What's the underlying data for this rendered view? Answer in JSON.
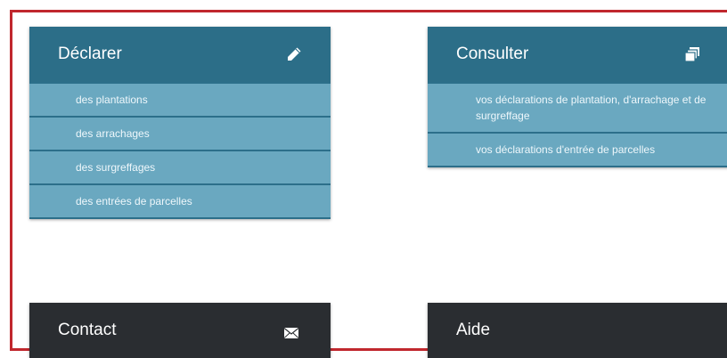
{
  "declarer": {
    "title": "Déclarer",
    "icon": "pencil-icon",
    "items": [
      {
        "label": "des plantations"
      },
      {
        "label": "des arrachages"
      },
      {
        "label": "des surgreffages"
      },
      {
        "label": "des entrées de parcelles"
      }
    ]
  },
  "consulter": {
    "title": "Consulter",
    "icon": "windows-stack-icon",
    "items": [
      {
        "label": "vos déclarations de plantation, d'arrachage et de surgreffage"
      },
      {
        "label": "vos déclarations d'entrée de parcelles"
      }
    ]
  },
  "contact": {
    "title": "Contact",
    "icon": "envelope-icon"
  },
  "aide": {
    "title": "Aide"
  },
  "colors": {
    "header_blue": "#2c6e88",
    "item_blue": "#6aa8c0",
    "header_dark": "#2a2d31",
    "frame_red": "#c0272d"
  }
}
